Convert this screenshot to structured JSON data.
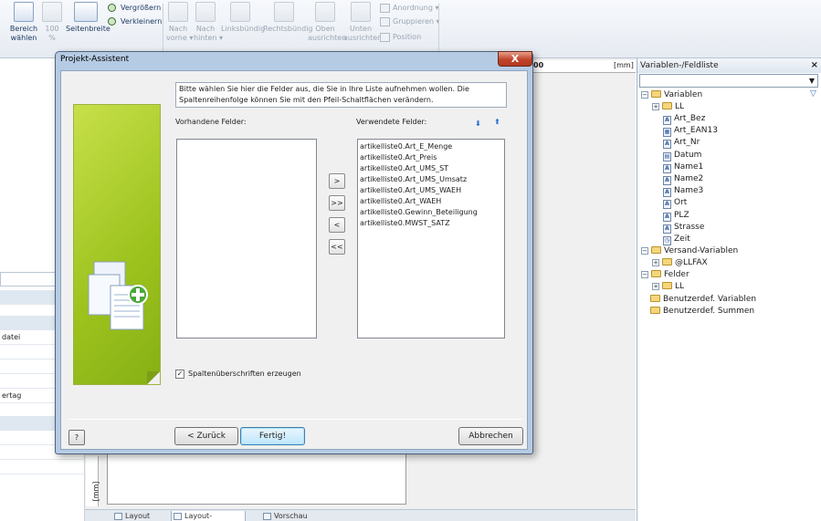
{
  "ribbon": {
    "bereich": "Bereich\nwählen",
    "zoom": "100\n%",
    "seitenbreite": "Seitenbreite",
    "vergroessern": "Vergrößern",
    "verkleinern": "Verkleinern",
    "nach_vorne": "Nach\nvorne ▾",
    "nach_hinten": "Nach\nhinten ▾",
    "linksbuendig": "Linksbündig",
    "rechtsbuendig": "Rechtsbündig",
    "oben": "Oben\nausrichten",
    "unten": "Unten\nausrichten",
    "anordnung": "Anordnung ▾",
    "gruppieren": "Gruppieren ▾",
    "position": "Position"
  },
  "left_panel": {
    "row1": "datei",
    "row2": "ertag"
  },
  "ruler": {
    "mark": "00",
    "unit": "[mm]"
  },
  "bottom_tabs": [
    "Layout",
    "Layout-Vorschau",
    "Vorschau"
  ],
  "right_panel": {
    "title": "Variablen-/Feldliste",
    "close": "×",
    "tree": {
      "variablen": "Variablen",
      "ll": "LL",
      "vars": [
        "Art_Bez",
        "Art_EAN13",
        "Art_Nr",
        "Datum",
        "Name1",
        "Name2",
        "Name3",
        "Ort",
        "PLZ",
        "Strasse",
        "Zeit"
      ],
      "versand": "Versand-Variablen",
      "llfax": "@LLFAX",
      "felder": "Felder",
      "felder_ll": "LL",
      "benutzer_var": "Benutzerdef. Variablen",
      "benutzer_sum": "Benutzerdef. Summen"
    }
  },
  "dialog": {
    "title": "Projekt-Assistent",
    "close": "X",
    "hint": "Bitte wählen Sie hier die Felder aus, die Sie in Ihre Liste aufnehmen wollen. Die Spaltenreihenfolge können Sie mit den Pfeil-Schaltflächen verändern.",
    "available_label": "Vorhandene Felder:",
    "used_label": "Verwendete Felder:",
    "used_fields": [
      "artikelliste0.Art_E_Menge",
      "artikelliste0.Art_Preis",
      "artikelliste0.Art_UMS_ST",
      "artikelliste0.Art_UMS_Umsatz",
      "artikelliste0.Art_UMS_WAEH",
      "artikelliste0.Art_WAEH",
      "artikelliste0.Gewinn_Beteiligung",
      "artikelliste0.MWST_SATZ"
    ],
    "move_buttons": [
      ">",
      ">>",
      "<",
      "<<"
    ],
    "checkbox_label": "Spaltenüberschriften erzeugen",
    "checkbox_checked": "✓",
    "help_button": "?",
    "back_button": "< Zurück",
    "finish_button": "Fertig!",
    "cancel_button": "Abbrechen"
  }
}
